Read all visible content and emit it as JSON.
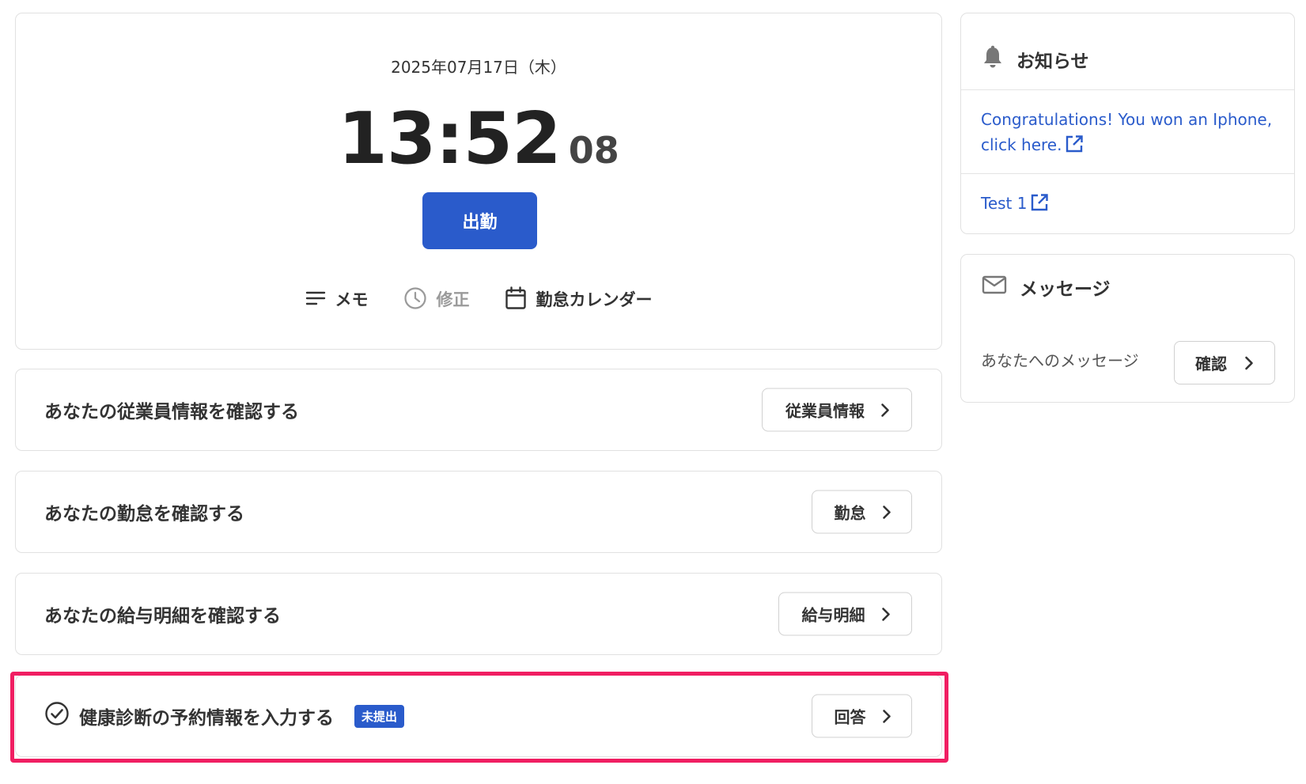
{
  "clock": {
    "date": "2025年07月17日（木）",
    "time": "13:52",
    "seconds": "08",
    "punch_label": "出勤"
  },
  "clock_actions": {
    "memo": "メモ",
    "correction": "修正",
    "calendar": "勤怠カレンダー"
  },
  "rows": {
    "employee": {
      "title": "あなたの従業員情報を確認する",
      "button": "従業員情報"
    },
    "attendance": {
      "title": "あなたの勤怠を確認する",
      "button": "勤怠"
    },
    "payslip": {
      "title": "あなたの給与明細を確認する",
      "button": "給与明細"
    },
    "health": {
      "title": "健康診断の予約情報を入力する",
      "badge": "未提出",
      "button": "回答"
    }
  },
  "notices": {
    "heading": "お知らせ",
    "items": [
      {
        "line1": "Congratulations! You won an Iphone,",
        "line2": "click here."
      },
      {
        "line1": "Test 1"
      }
    ]
  },
  "messages": {
    "heading": "メッセージ",
    "label": "あなたへのメッセージ",
    "button": "確認"
  },
  "colors": {
    "primary": "#2a5bcb",
    "highlight": "#f01e62",
    "text": "#333333",
    "border": "#e1e1e1"
  },
  "icons": [
    "memo-icon",
    "clock-icon",
    "calendar-icon",
    "bell-icon",
    "mail-icon",
    "external-link-icon",
    "chevron-right-icon",
    "check-circle-icon"
  ]
}
